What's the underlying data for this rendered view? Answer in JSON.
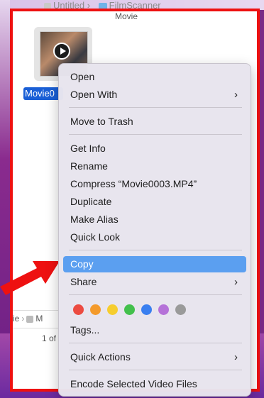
{
  "finder": {
    "title_left": "Untitled",
    "title_arrow": "›",
    "title_folder": "FilmScanner",
    "title_subfolder": "Movie",
    "file_label": "Movie0",
    "path_item_1": "rie",
    "path_item_2": "M",
    "status_text": "1 of"
  },
  "menu": {
    "open": "Open",
    "open_with": "Open With",
    "move_to_trash": "Move to Trash",
    "get_info": "Get Info",
    "rename": "Rename",
    "compress": "Compress “Movie0003.MP4”",
    "duplicate": "Duplicate",
    "make_alias": "Make Alias",
    "quick_look": "Quick Look",
    "copy": "Copy",
    "share": "Share",
    "tags": "Tags...",
    "quick_actions": "Quick Actions",
    "encode": "Encode Selected Video Files",
    "chevron": "›",
    "selected_item": "Copy"
  },
  "tag_colors": [
    "#ec4b41",
    "#f49a2b",
    "#f6cd2e",
    "#43c04c",
    "#3a7ff0",
    "#b572d8",
    "#9a9a9a"
  ],
  "colors": {
    "highlight": "#5b9ff0",
    "annotation_red": "#ee1111",
    "selection_blue": "#1a5fd6"
  }
}
